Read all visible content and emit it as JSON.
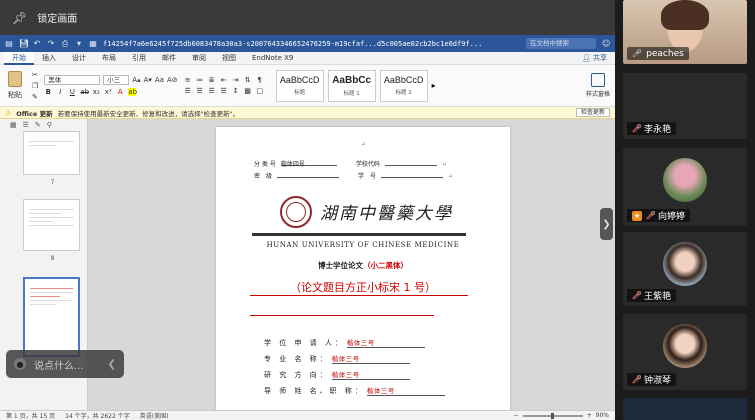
{
  "lockbar": {
    "label": "锁定画面"
  },
  "word": {
    "doc_title": "f14254f7a6e6245f725db6083478a30a3-s2007643346652476259-m19cfaf...d5c005ae02cb2bc1e6df9f...",
    "search_placeholder": "在文档中搜索",
    "tabs": [
      "开始",
      "插入",
      "设计",
      "布局",
      "引用",
      "邮件",
      "审阅",
      "视图",
      "EndNote X9"
    ],
    "share": "共享",
    "paste_label": "粘贴",
    "font_name": "黑体",
    "font_size": "小三",
    "styles": [
      {
        "sample": "AaBbCcD",
        "name": "标题"
      },
      {
        "sample": "AaBbCc",
        "name": "标题 1"
      },
      {
        "sample": "AaBbCcD",
        "name": "标题 2"
      }
    ],
    "panes_label": "样式窗格",
    "notice": {
      "title": "Office 更新",
      "text": "若要保持使用最新安全更新、修复和改进，请选择\"检查更新\"。",
      "button": "检查更新"
    },
    "sidebar": {
      "thumb_labels": [
        "7",
        "8",
        "9"
      ]
    },
    "page": {
      "class_no_label": "分 类 号",
      "class_no_value": "楷体四号",
      "school_code_label": "学校代码",
      "secret_label": "密　级",
      "student_no_label": "学　号",
      "university_cn": "湖南中醫藥大學",
      "university_en": "HUNAN UNIVERSITY OF CHINESE MEDICINE",
      "thesis_type": "博士学位论文",
      "thesis_type_note": "（小二黑体）",
      "title_placeholder": "（论文题目方正小标宋 1 号）",
      "fields": [
        {
          "label": "学 位 申 请 人：",
          "value": "楷体三号"
        },
        {
          "label": "专 业 名 称：",
          "value": "楷体三号"
        },
        {
          "label": "研 究 方 向：",
          "value": "楷体三号"
        },
        {
          "label": "导 师 姓 名、职 称：",
          "value": "楷体三号"
        }
      ]
    },
    "status": {
      "page": "第 1 页，共 15 页",
      "words": "14 个字，共 2622 个字",
      "language": "英语(美国)",
      "zoom": "90%"
    }
  },
  "voice_input": {
    "placeholder": "说点什么..."
  },
  "participants": [
    {
      "name": "peaches",
      "mic": "on",
      "kind": "video"
    },
    {
      "name": "李永艳",
      "mic": "off",
      "kind": "blank"
    },
    {
      "name": "向婷婷",
      "mic": "host",
      "kind": "avatar"
    },
    {
      "name": "王紫艳",
      "mic": "off",
      "kind": "avatar"
    },
    {
      "name": "钟淑琴",
      "mic": "off",
      "kind": "avatar"
    }
  ]
}
